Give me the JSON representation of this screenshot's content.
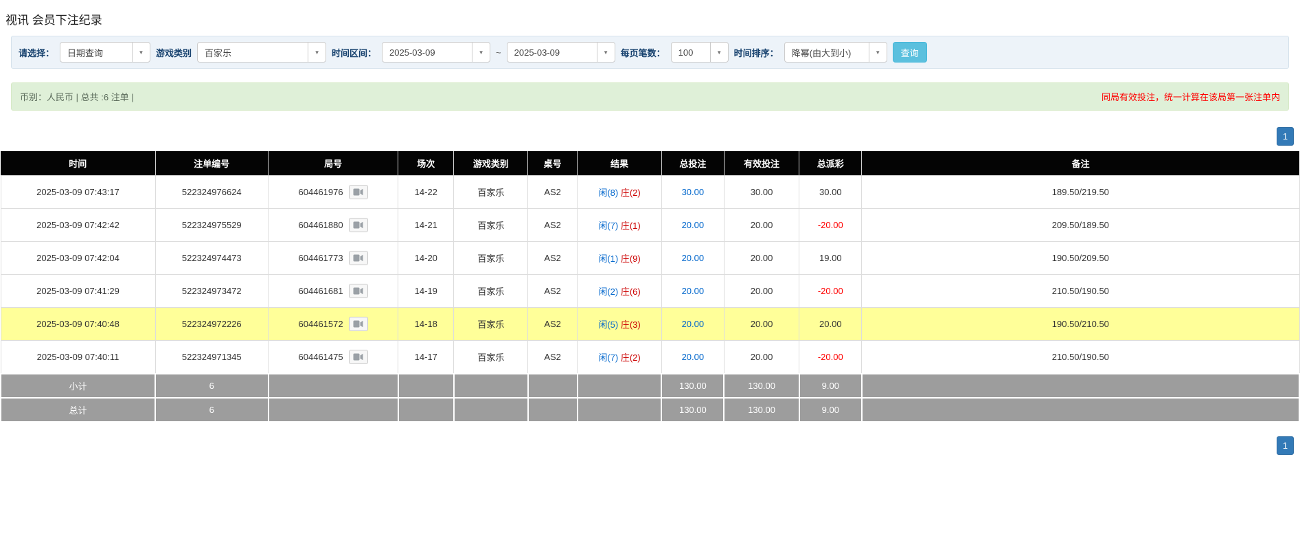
{
  "page": {
    "title": "视讯 会员下注纪录"
  },
  "colors": {
    "player_blue": "#0066cc",
    "banker_red": "#cc0000",
    "negative_red": "#ff0000",
    "link_blue": "#0066cc",
    "row_highlight": "#ffff99",
    "search_button": "#5bc0de",
    "pager_blue": "#337ab7",
    "summary_bar_green": "#dff0d8",
    "header_black": "#040404",
    "footer_gray": "#9d9d9d"
  },
  "filters": {
    "select_label": "请选择：",
    "select_value": "日期查询",
    "game_type_label": "游戏类别",
    "game_type_value": "百家乐",
    "date_range_label": "时间区间：",
    "date_from": "2025-03-09",
    "date_separator": "~",
    "date_to": "2025-03-09",
    "page_size_label": "每页笔数：",
    "page_size_value": "100",
    "sort_label": "时间排序：",
    "sort_value": "降幂(由大到小)",
    "search_button_label": "查询"
  },
  "summary": {
    "left": "币别：人民币 | 总共 :6 注单 |",
    "right": "同局有效投注，统一计算在该局第一张注单内"
  },
  "pagination": {
    "current_page": "1"
  },
  "table": {
    "headers": [
      "时间",
      "注单编号",
      "局号",
      "场次",
      "游戏类别",
      "桌号",
      "结果",
      "总投注",
      "有效投注",
      "总派彩",
      "备注"
    ],
    "rows": [
      {
        "time": "2025-03-09 07:43:17",
        "bet_id": "522324976624",
        "round_id": "604461976",
        "session": "14-22",
        "game_type": "百家乐",
        "table_no": "AS2",
        "result_player": "闲(8)",
        "result_banker": "庄(2)",
        "total_bet": "30.00",
        "valid_bet": "30.00",
        "payout": "30.00",
        "note": "189.50/219.50",
        "highlight": false
      },
      {
        "time": "2025-03-09 07:42:42",
        "bet_id": "522324975529",
        "round_id": "604461880",
        "session": "14-21",
        "game_type": "百家乐",
        "table_no": "AS2",
        "result_player": "闲(7)",
        "result_banker": "庄(1)",
        "total_bet": "20.00",
        "valid_bet": "20.00",
        "payout": "-20.00",
        "note": "209.50/189.50",
        "highlight": false
      },
      {
        "time": "2025-03-09 07:42:04",
        "bet_id": "522324974473",
        "round_id": "604461773",
        "session": "14-20",
        "game_type": "百家乐",
        "table_no": "AS2",
        "result_player": "闲(1)",
        "result_banker": "庄(9)",
        "total_bet": "20.00",
        "valid_bet": "20.00",
        "payout": "19.00",
        "note": "190.50/209.50",
        "highlight": false
      },
      {
        "time": "2025-03-09 07:41:29",
        "bet_id": "522324973472",
        "round_id": "604461681",
        "session": "14-19",
        "game_type": "百家乐",
        "table_no": "AS2",
        "result_player": "闲(2)",
        "result_banker": "庄(6)",
        "total_bet": "20.00",
        "valid_bet": "20.00",
        "payout": "-20.00",
        "note": "210.50/190.50",
        "highlight": false
      },
      {
        "time": "2025-03-09 07:40:48",
        "bet_id": "522324972226",
        "round_id": "604461572",
        "session": "14-18",
        "game_type": "百家乐",
        "table_no": "AS2",
        "result_player": "闲(5)",
        "result_banker": "庄(3)",
        "total_bet": "20.00",
        "valid_bet": "20.00",
        "payout": "20.00",
        "note": "190.50/210.50",
        "highlight": true
      },
      {
        "time": "2025-03-09 07:40:11",
        "bet_id": "522324971345",
        "round_id": "604461475",
        "session": "14-17",
        "game_type": "百家乐",
        "table_no": "AS2",
        "result_player": "闲(7)",
        "result_banker": "庄(2)",
        "total_bet": "20.00",
        "valid_bet": "20.00",
        "payout": "-20.00",
        "note": "210.50/190.50",
        "highlight": false
      }
    ],
    "footer": [
      {
        "label": "小计",
        "count": "6",
        "total_bet": "130.00",
        "valid_bet": "130.00",
        "payout": "9.00"
      },
      {
        "label": "总计",
        "count": "6",
        "total_bet": "130.00",
        "valid_bet": "130.00",
        "payout": "9.00"
      }
    ]
  }
}
